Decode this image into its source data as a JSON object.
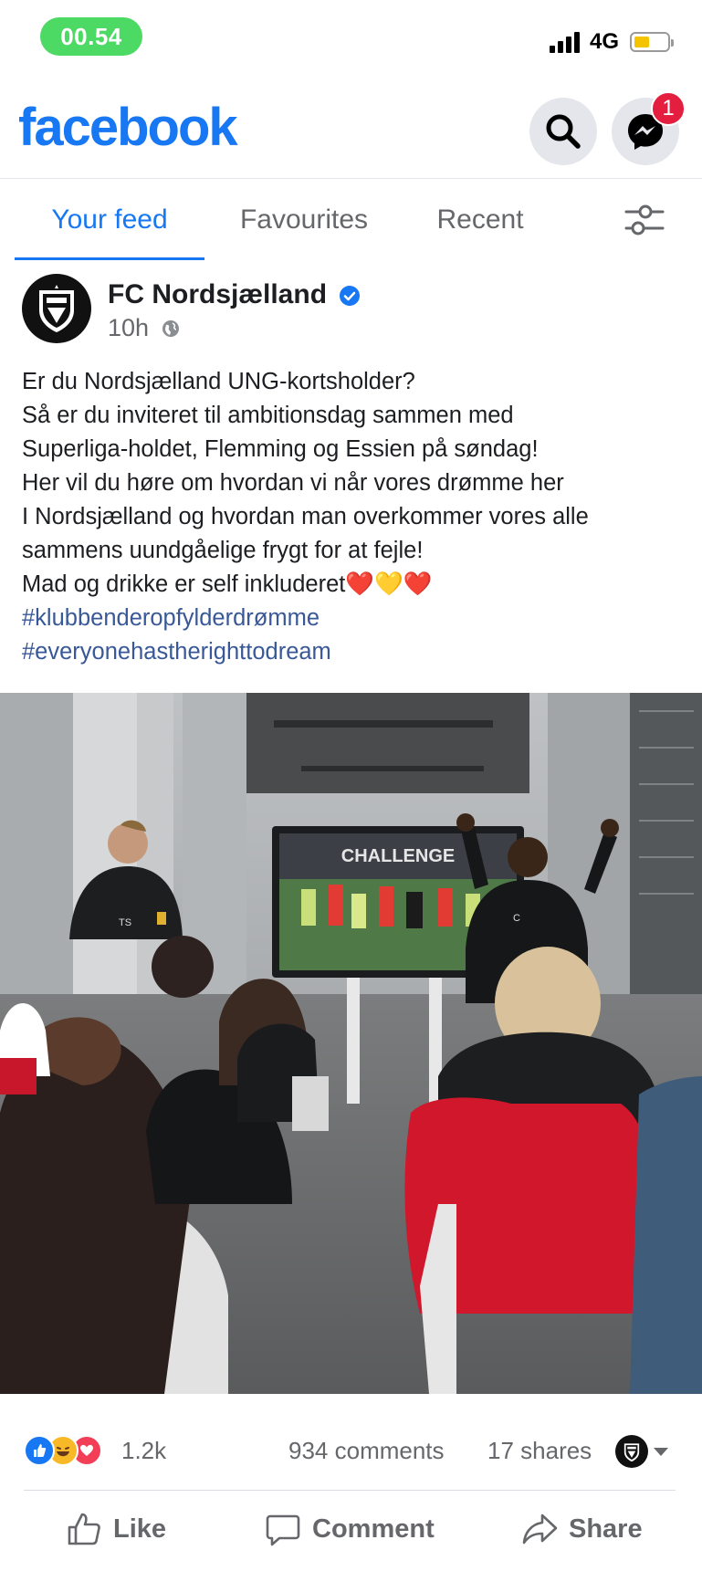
{
  "status_bar": {
    "time": "00.54",
    "network": "4G",
    "battery_level": 0.45,
    "colors": {
      "time_pill": "#4cd964",
      "battery_fill": "#f5c400"
    }
  },
  "header": {
    "logo": "facebook",
    "search_icon": "search-icon",
    "messenger_icon": "messenger-icon",
    "messenger_badge": "1",
    "colors": {
      "brand": "#1877f2",
      "badge": "#e41e3f"
    }
  },
  "tabs": [
    {
      "label": "Your feed",
      "active": true
    },
    {
      "label": "Favourites",
      "active": false
    },
    {
      "label": "Recent",
      "active": false
    }
  ],
  "filter_icon": "sliders-icon",
  "post": {
    "page_name": "FC Nordsjælland",
    "verified": true,
    "time": "10h",
    "audience_icon": "globe-icon",
    "text_lines": [
      "Er du Nordsjælland UNG-kortsholder?",
      "Så er du inviteret til ambitionsdag sammen med",
      "Superliga-holdet, Flemming og Essien på søndag!",
      "Her vil du høre om hvordan vi når vores drømme her",
      "I Nordsjælland og hvordan man overkommer vores alle",
      "sammens uundgåelige frygt for at fejle!",
      "Mad og drikke er self inkluderet❤️💛❤️"
    ],
    "hashtags": [
      "#klubbenderopfylderdrømme",
      "#everyonehastherighttodream"
    ],
    "image": {
      "screen_text": "CHALLENGE",
      "jacket_left_initials": "TS",
      "jacket_right_initial": "C"
    },
    "reactions": {
      "icons": [
        "like-icon",
        "haha-icon",
        "love-icon"
      ],
      "count": "1.2k",
      "comments": "934 comments",
      "shares": "17 shares"
    },
    "actions": {
      "like": "Like",
      "comment": "Comment",
      "share": "Share"
    }
  }
}
